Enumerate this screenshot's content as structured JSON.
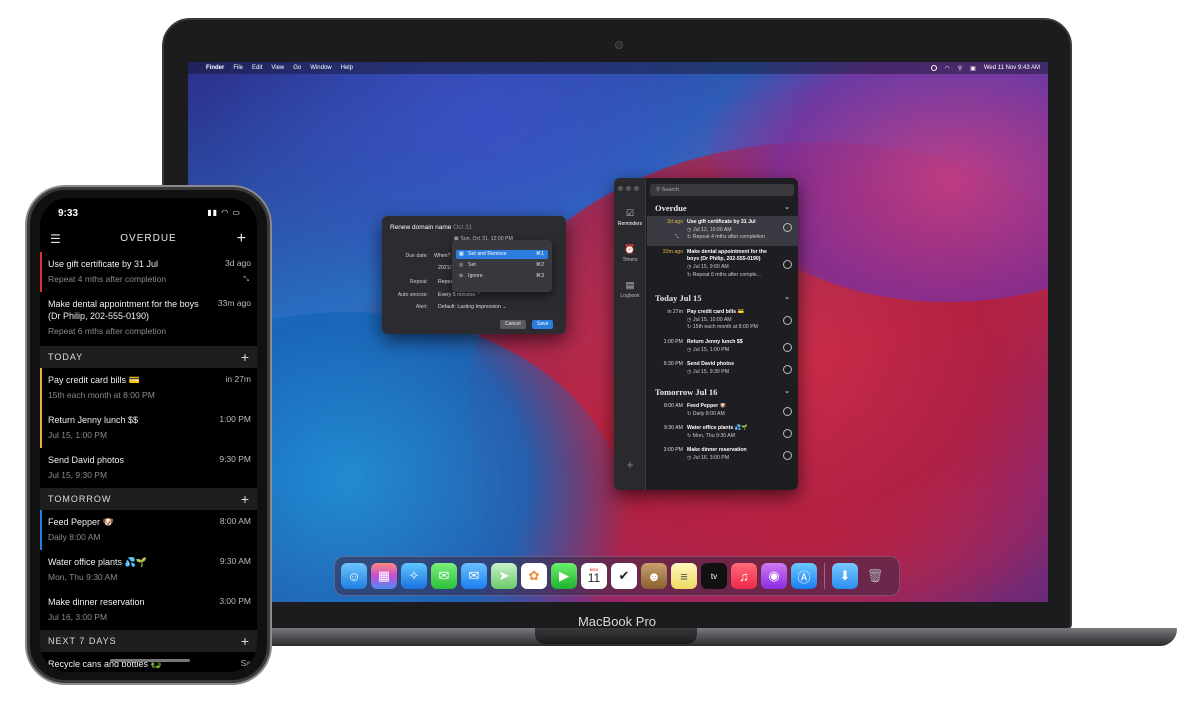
{
  "mac": {
    "menubar": {
      "app": "Finder",
      "items": [
        "File",
        "Edit",
        "View",
        "Go",
        "Window",
        "Help"
      ],
      "clock": "Wed 11 Nov  9:43 AM"
    },
    "reminders_window": {
      "search_placeholder": "Search",
      "sidebar": [
        {
          "label": "Reminders",
          "icon": "checklist-icon"
        },
        {
          "label": "Timers",
          "icon": "alarm-icon"
        },
        {
          "label": "Logbook",
          "icon": "logbook-icon"
        }
      ],
      "sections": [
        {
          "title": "Overdue",
          "items": [
            {
              "when": "3d ago",
              "title": "Use gift certificate by 31 Jul",
              "date": "Jul 12, 10:00 AM",
              "repeat": "Repeat 4 mths after completion",
              "overdue": true,
              "selected": true
            },
            {
              "when": "33m ago",
              "title": "Make dental appointment for the boys (Dr Philip, 202-555-0190)",
              "date": "Jul 15, 9:00 AM",
              "repeat": "Repeat 6 mths after comple...",
              "overdue": true
            }
          ]
        },
        {
          "title": "Today Jul 15",
          "items": [
            {
              "when": "in 27m",
              "title": "Pay credit card bills 💳",
              "date": "Jul 15, 10:00 AM",
              "repeat": "15th each month at 8:00 PM"
            },
            {
              "when": "1:00 PM",
              "title": "Return Jenny lunch $$",
              "date": "Jul 15, 1:00 PM"
            },
            {
              "when": "9:30 PM",
              "title": "Send David photos",
              "date": "Jul 15, 9:30 PM"
            }
          ]
        },
        {
          "title": "Tomorrow Jul 16",
          "items": [
            {
              "when": "8:00 AM",
              "title": "Feed Pepper 🐶",
              "date": "Daily 8:00 AM"
            },
            {
              "when": "9:30 AM",
              "title": "Water office plants 💦🌱",
              "date": "Mon, Thu 9:30 AM"
            },
            {
              "when": "3:00 PM",
              "title": "Make dinner reservation",
              "date": "Jul 16, 3:00 PM"
            }
          ]
        }
      ]
    },
    "dialog": {
      "title": "Renew domain name",
      "title_hint": "Oct 31",
      "due_label": "Due date:",
      "due_when": "When?",
      "due_value": "2021/1",
      "suggestion": "Sun, Oct 31, 12:00 PM",
      "menu": [
        {
          "label": "Set and Remove",
          "kb": "⌘1",
          "highlight": true
        },
        {
          "label": "Set",
          "kb": "⌘2"
        },
        {
          "label": "Ignore",
          "kb": "⌘3"
        }
      ],
      "repeat_label": "Repeat:",
      "repeat_value": "Repeat",
      "snooze_label": "Auto snooze:",
      "snooze_value": "Every 5 minutes ⌃",
      "alert_label": "Alert:",
      "alert_value": "Default: Lasting Impression ⌄",
      "cancel": "Cancel",
      "save": "Save"
    },
    "dock": {
      "calendar_month": "NOV",
      "calendar_day": "11",
      "tv_label": "tv"
    },
    "model": "MacBook Pro"
  },
  "phone": {
    "time": "9:33",
    "title": "OVERDUE",
    "items_overdue": [
      {
        "title": "Use gift certificate by 31 Jul",
        "sub": "Repeat 4 mths after completion",
        "right": "3d ago"
      },
      {
        "title": "Make dental appointment for the boys (Dr Philip, 202-555-0190)",
        "sub": "Repeat 6 mths after completion",
        "right": "33m ago"
      }
    ],
    "sec_today": "TODAY",
    "items_today": [
      {
        "title": "Pay credit card bills 💳",
        "sub": "15th each month at 8:00 PM",
        "right": "in 27m"
      },
      {
        "title": "Return Jenny lunch $$",
        "sub": "Jul 15, 1:00 PM",
        "right": "1:00 PM"
      },
      {
        "title": "Send David photos",
        "sub": "Jul 15, 9:30 PM",
        "right": "9:30 PM"
      }
    ],
    "sec_tomorrow": "TOMORROW",
    "items_tomorrow": [
      {
        "title": "Feed Pepper 🐶",
        "sub": "Daily 8:00 AM",
        "right": "8:00 AM"
      },
      {
        "title": "Water office plants 💦🌱",
        "sub": "Mon, Thu 9:30 AM",
        "right": "9:30 AM"
      },
      {
        "title": "Make dinner reservation",
        "sub": "Jul 16, 3:00 PM",
        "right": "3:00 PM"
      }
    ],
    "sec_next7": "NEXT 7 DAYS",
    "items_next7": [
      {
        "title": "Recycle cans and bottles ♻️",
        "right": "Sa"
      }
    ]
  }
}
